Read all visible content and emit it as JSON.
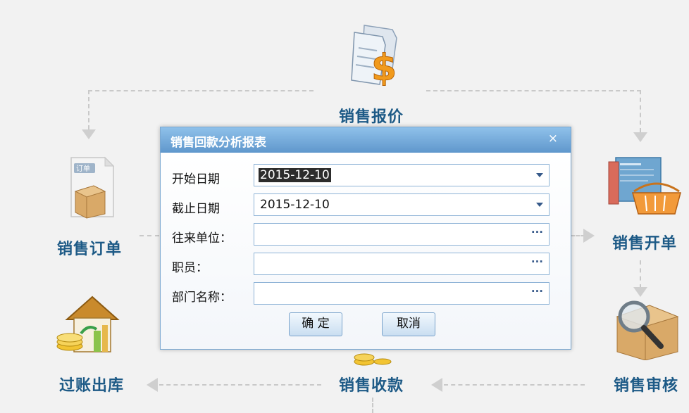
{
  "workflow": {
    "quote_label": "销售报价",
    "order_label": "销售订单",
    "invoice_label": "销售开单",
    "receipt_label": "销售收款",
    "audit_label": "销售审核",
    "posting_label": "过账出库",
    "order_doc_tag": "订单"
  },
  "dialog": {
    "title": "销售回款分析报表",
    "close_glyph": "×",
    "fields": [
      {
        "label": "开始日期",
        "value": "2015-12-10",
        "trigger": "dropdown"
      },
      {
        "label": "截止日期",
        "value": "2015-12-10",
        "trigger": "dropdown"
      },
      {
        "label": "往来单位：",
        "value": "",
        "trigger": "ellipsis"
      },
      {
        "label": "职员：",
        "value": "",
        "trigger": "ellipsis"
      },
      {
        "label": "部门名称：",
        "value": "",
        "trigger": "ellipsis"
      }
    ],
    "ellipsis_glyph": "···",
    "ok_label": "确 定",
    "cancel_label": "取消"
  },
  "colors": {
    "label_blue": "#1d5a86",
    "dialog_header": "#6fa6d8",
    "money_orange": "#f19a1c"
  }
}
